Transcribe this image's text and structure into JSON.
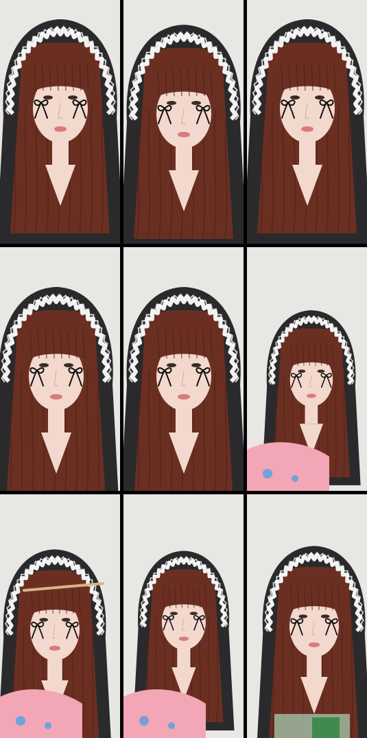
{
  "grid": {
    "rows": 3,
    "columns": 3,
    "background_color": "#000000"
  },
  "palette": {
    "wall": "#e9e7e4",
    "hood": "#2a2a2c",
    "lace": "#f2f2f2",
    "hair": "#6b2f22",
    "hair_dark": "#4a1f17",
    "skin": "#f3d8cd",
    "lips": "#d97b7b",
    "bow_sticker": "#111111",
    "blanket_pink": "#f2a6b6",
    "blanket_blue": "#6fa2d8"
  },
  "frames": [
    {
      "id": "frame-1",
      "subject": "person-in-lace-hood",
      "stickers": "bow-icon",
      "extra": "none"
    },
    {
      "id": "frame-2",
      "subject": "person-in-lace-hood",
      "stickers": "bow-icon",
      "extra": "none"
    },
    {
      "id": "frame-3",
      "subject": "person-in-lace-hood",
      "stickers": "bow-icon",
      "extra": "none"
    },
    {
      "id": "frame-4",
      "subject": "person-in-lace-hood",
      "stickers": "bow-icon",
      "extra": "none"
    },
    {
      "id": "frame-5",
      "subject": "person-in-lace-hood",
      "stickers": "bow-icon",
      "extra": "none"
    },
    {
      "id": "frame-6",
      "subject": "person-in-lace-hood",
      "stickers": "bow-icon",
      "extra": "pink-blanket"
    },
    {
      "id": "frame-7",
      "subject": "person-in-lace-hood",
      "stickers": "bow-icon",
      "extra": "stick-and-blanket"
    },
    {
      "id": "frame-8",
      "subject": "person-in-lace-hood",
      "stickers": "bow-icon",
      "extra": "pink-blanket"
    },
    {
      "id": "frame-9",
      "subject": "person-in-lace-hood",
      "stickers": "bow-icon",
      "extra": "green-bag"
    }
  ]
}
